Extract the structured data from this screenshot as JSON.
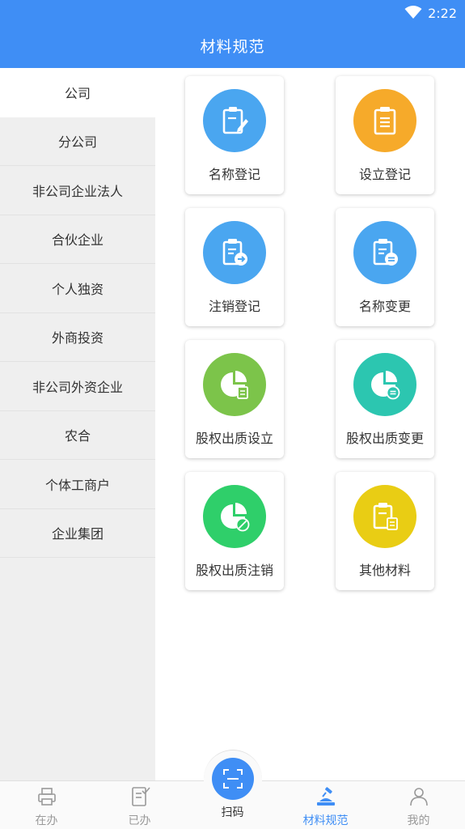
{
  "status": {
    "time": "2:22"
  },
  "header": {
    "title": "材料规范"
  },
  "sidebar": {
    "items": [
      {
        "label": "公司",
        "active": true
      },
      {
        "label": "分公司"
      },
      {
        "label": "非公司企业法人"
      },
      {
        "label": "合伙企业"
      },
      {
        "label": "个人独资"
      },
      {
        "label": "外商投资"
      },
      {
        "label": "非公司外资企业"
      },
      {
        "label": "农合"
      },
      {
        "label": "个体工商户"
      },
      {
        "label": "企业集团"
      }
    ]
  },
  "grid": {
    "items": [
      {
        "label": "名称登记",
        "icon": "clipboard-pen-icon",
        "color": "#4aa6f0"
      },
      {
        "label": "设立登记",
        "icon": "clipboard-list-icon",
        "color": "#f6aa2a"
      },
      {
        "label": "注销登记",
        "icon": "clipboard-arrow-icon",
        "color": "#4aa6f0"
      },
      {
        "label": "名称变更",
        "icon": "clipboard-minus-icon",
        "color": "#4aa6f0"
      },
      {
        "label": "股权出质设立",
        "icon": "pie-document-icon",
        "color": "#7cc44a"
      },
      {
        "label": "股权出质变更",
        "icon": "pie-minus-icon",
        "color": "#2cc6b0"
      },
      {
        "label": "股权出质注销",
        "icon": "pie-cancel-icon",
        "color": "#2fcf6a"
      },
      {
        "label": "其他材料",
        "icon": "clipboard-doc-icon",
        "color": "#e9cd14"
      }
    ]
  },
  "tabs": {
    "items": [
      {
        "label": "在办",
        "icon": "printer-icon"
      },
      {
        "label": "已办",
        "icon": "checklist-icon"
      },
      {
        "label": "扫码",
        "icon": "scan-icon"
      },
      {
        "label": "材料规范",
        "icon": "gavel-icon",
        "active": true
      },
      {
        "label": "我的",
        "icon": "person-icon"
      }
    ]
  },
  "colors": {
    "primary": "#3f8ef5",
    "sidebar_bg": "#efefef"
  }
}
